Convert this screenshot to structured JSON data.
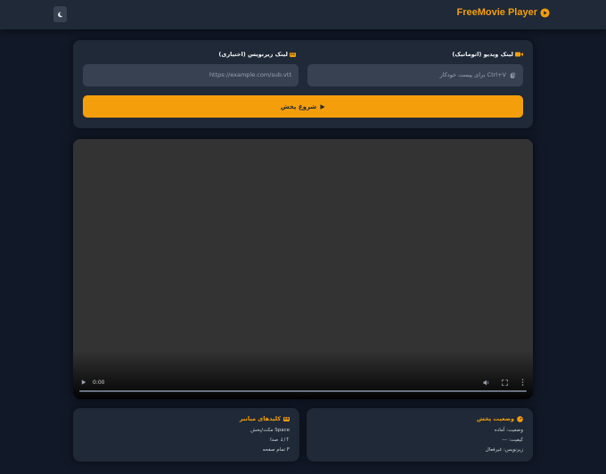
{
  "header": {
    "brand": "FreeMovie Player",
    "theme_icon": "moon-icon",
    "brand_icon": "play-circle-icon"
  },
  "form": {
    "video_label": "لینک ویدیو (اتوماتیک)",
    "video_placeholder": "Ctrl+V برای پیست خودکار",
    "video_icon": "video-camera-icon",
    "paste_icon": "clipboard-icon",
    "subtitle_label": "لینک زیرنویس (اختیاری)",
    "subtitle_placeholder": "https://example.com/sub.vtt",
    "subtitle_badge": "CC",
    "play_label": "شروع پخش"
  },
  "video": {
    "time": "0:00"
  },
  "status": {
    "title": "وضعیت پخش",
    "state": "وضعیت: آماده",
    "quality": "کیفیت: ---",
    "subtitle": "زیرنویس: غیرفعال"
  },
  "shortcuts": {
    "title": "کلیدهای میانبر",
    "badge": "KB",
    "play_pause": "Space مکث/پخش",
    "volume": "↑/↓ صدا",
    "fullscreen": "F تمام صفحه"
  },
  "colors": {
    "accent": "#f59e0b",
    "background": "#111827",
    "card": "#1f2937",
    "input": "#374151"
  }
}
